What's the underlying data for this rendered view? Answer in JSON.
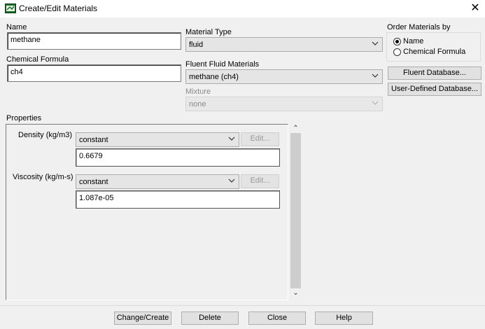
{
  "window": {
    "title": "Create/Edit Materials"
  },
  "fields": {
    "name_label": "Name",
    "name_value": "methane",
    "formula_label": "Chemical Formula",
    "formula_value": "ch4",
    "material_type_label": "Material Type",
    "material_type_value": "fluid",
    "fluent_materials_label": "Fluent Fluid Materials",
    "fluent_materials_value": "methane (ch4)",
    "mixture_label": "Mixture",
    "mixture_value": "none"
  },
  "order": {
    "label": "Order Materials by",
    "options": [
      {
        "label": "Name",
        "selected": true
      },
      {
        "label": "Chemical Formula",
        "selected": false
      }
    ]
  },
  "database_buttons": {
    "fluent": "Fluent Database...",
    "user": "User-Defined Database..."
  },
  "properties": {
    "label": "Properties",
    "rows": [
      {
        "label": "Density (kg/m3)",
        "method": "constant",
        "edit": "Edit...",
        "value": "0.6679"
      },
      {
        "label": "Viscosity (kg/m-s)",
        "method": "constant",
        "edit": "Edit...",
        "value": "1.087e-05"
      }
    ]
  },
  "footer": {
    "change_create": "Change/Create",
    "delete": "Delete",
    "close": "Close",
    "help": "Help"
  },
  "icons": {
    "app": "fluent-app-icon",
    "close": "close-icon",
    "dropdown": "chevron-down-icon",
    "scroll_up": "scroll-up-icon",
    "scroll_down": "scroll-down-icon"
  }
}
